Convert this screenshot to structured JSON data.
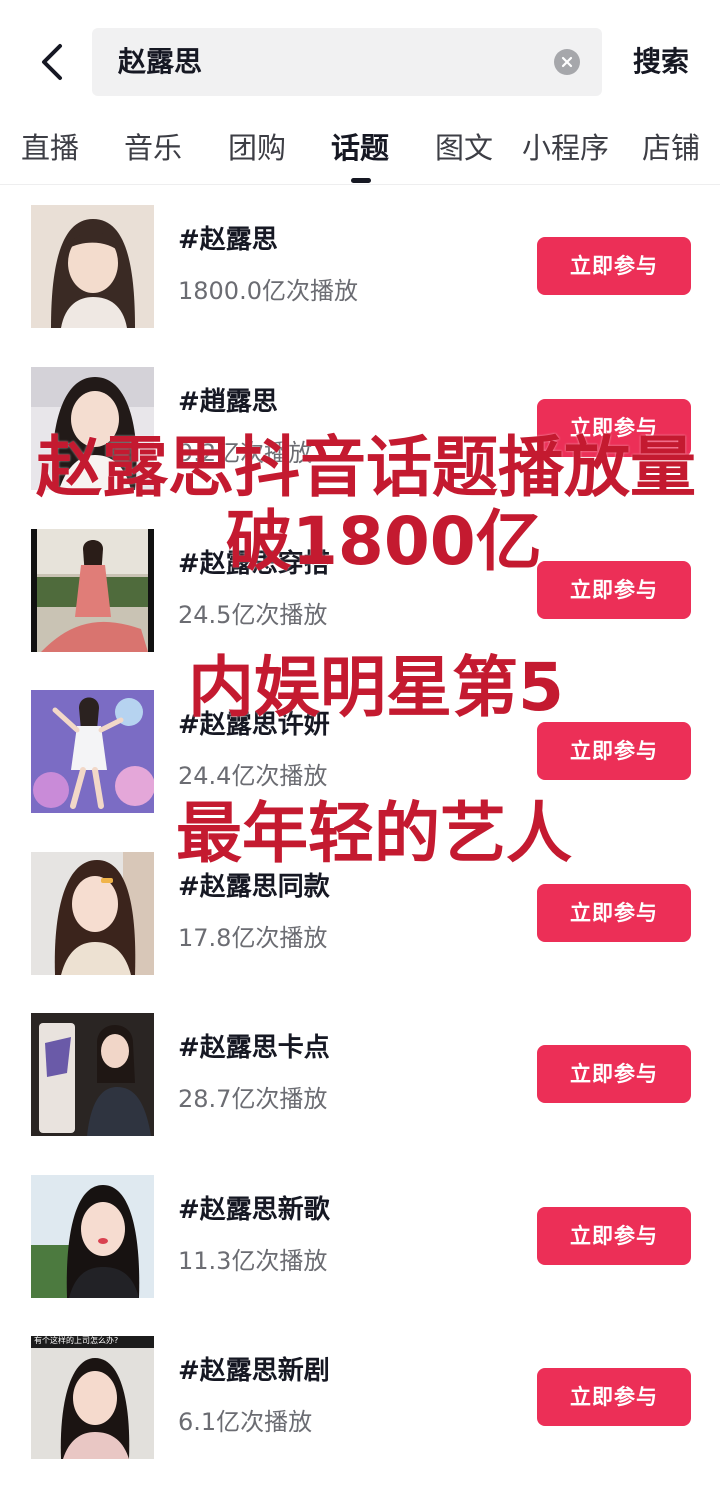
{
  "search": {
    "query": "赵露思",
    "button_label": "搜索"
  },
  "tabs": [
    {
      "label": "直播",
      "active": false
    },
    {
      "label": "音乐",
      "active": false
    },
    {
      "label": "团购",
      "active": false
    },
    {
      "label": "话题",
      "active": true
    },
    {
      "label": "图文",
      "active": false
    },
    {
      "label": "小程序",
      "active": false
    },
    {
      "label": "店铺",
      "active": false
    }
  ],
  "results": [
    {
      "title": "#赵露思",
      "plays": "1800.0亿次播放",
      "button": "立即参与"
    },
    {
      "title": "#趙露思",
      "plays": "9.2亿次播放",
      "button": "立即参与"
    },
    {
      "title": "#赵露思穿搭",
      "plays": "24.5亿次播放",
      "button": "立即参与"
    },
    {
      "title": "#赵露思许妍",
      "plays": "24.4亿次播放",
      "button": "立即参与"
    },
    {
      "title": "#赵露思同款",
      "plays": "17.8亿次播放",
      "button": "立即参与"
    },
    {
      "title": "#赵露思卡点",
      "plays": "28.7亿次播放",
      "button": "立即参与"
    },
    {
      "title": "#赵露思新歌",
      "plays": "11.3亿次播放",
      "button": "立即参与"
    },
    {
      "title": "#赵露思新剧",
      "plays": "6.1亿次播放",
      "button": "立即参与"
    }
  ],
  "thumbnail_caption": "有个这样的上司怎么办?",
  "overlay": {
    "line1": "赵露思抖音话题播放量",
    "line2": "破1800亿",
    "line3": "内娱明星第5",
    "line4": "最年轻的艺人"
  },
  "colors": {
    "accent": "#ec2f57",
    "overlay_text": "#c41a30"
  }
}
